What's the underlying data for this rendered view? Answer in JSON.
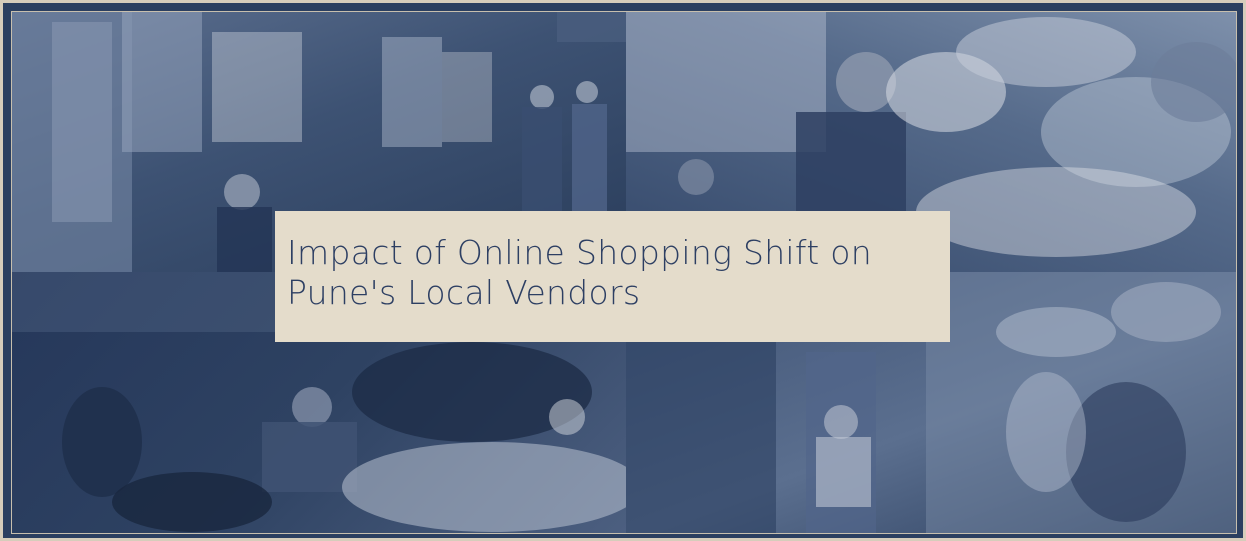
{
  "banner": {
    "title": "Impact of Online Shopping Shift on Pune's Local Vendors"
  },
  "images": [
    {
      "name": "textile-stall-photo"
    },
    {
      "name": "flower-vendor-photo"
    },
    {
      "name": "fruit-vegetable-vendor-photo"
    },
    {
      "name": "footwear-stall-photo"
    }
  ],
  "colors": {
    "frame": "#2b3f60",
    "border": "#d6cdbb",
    "title_bg": "#e4dccb",
    "title_text": "#2d3f63"
  }
}
